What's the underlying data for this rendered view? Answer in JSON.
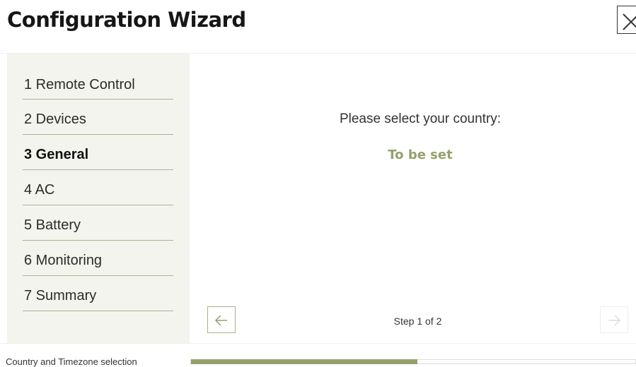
{
  "header": {
    "title": "Configuration Wizard",
    "close_icon": "close-icon"
  },
  "sidebar": {
    "steps": [
      {
        "label": "1 Remote Control",
        "active": false
      },
      {
        "label": "2 Devices",
        "active": false
      },
      {
        "label": "3 General",
        "active": true
      },
      {
        "label": "4 AC",
        "active": false
      },
      {
        "label": "5 Battery",
        "active": false
      },
      {
        "label": "6 Monitoring",
        "active": false
      },
      {
        "label": "7 Summary",
        "active": false
      }
    ]
  },
  "main": {
    "question": "Please select your country:",
    "value": "To be set",
    "step_indicator": "Step 1 of 2",
    "back_icon": "arrow-left-icon",
    "next_icon": "arrow-right-icon"
  },
  "footer": {
    "label": "Country and Timezone selection",
    "progress": 0.51
  },
  "colors": {
    "accent": "#94a16b",
    "divider": "#a7b38f",
    "sidebar_bg": "#f4f4ef"
  }
}
